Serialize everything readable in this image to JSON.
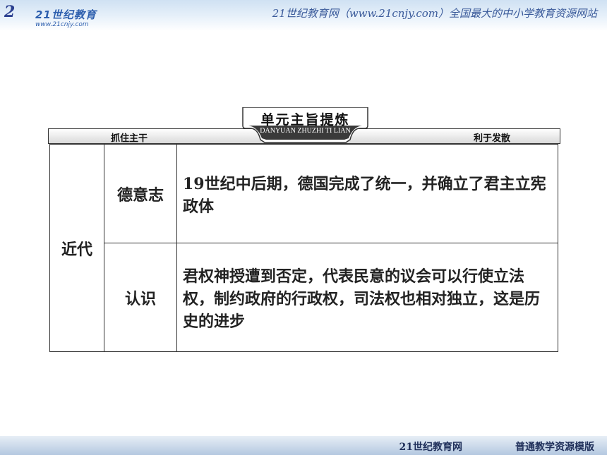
{
  "top_bar": {
    "logo_mark": "2",
    "logo_brand": "21世纪教育",
    "logo_url": "www.21cnjy.com",
    "tagline": "21世纪教育网（www.21cnjy.com）全国最大的中小学教育资源网站"
  },
  "section": {
    "title": "单元主旨提炼",
    "pinyin": "DANYUAN ZHUZHI TI LIAN",
    "header_left": "抓住主干",
    "header_right": "利于发散"
  },
  "table": {
    "era": "近代",
    "rows": [
      {
        "topic": "德意志",
        "content": "19世纪中后期，德国完成了统一，并确立了君主立宪政体"
      },
      {
        "topic": "认识",
        "content": "君权神授遭到否定，代表民意的议会可以行使立法权，制约政府的行政权，司法权也相对独立，这是历史的进步"
      }
    ]
  },
  "footer": {
    "site": "21世纪教育网",
    "slogan": "普通教学资源模版"
  }
}
